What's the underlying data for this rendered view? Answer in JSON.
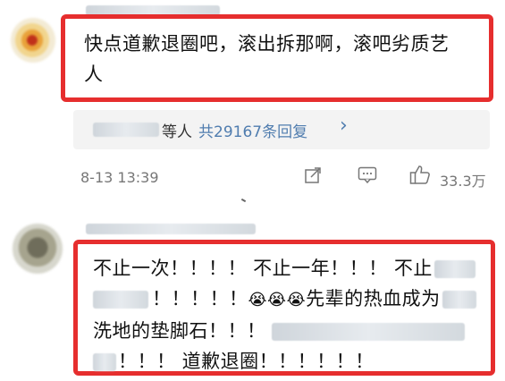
{
  "comments": [
    {
      "text_line1": "快点道歉退圈吧，滚出拆那啊，滚吧劣质艺",
      "text_line2": "人",
      "reply_count_text": "共29167条回复",
      "reply_users_suffix": "等人",
      "reply_arrow": "›",
      "time": "8-13 13:39",
      "like_count": "33.3万"
    },
    {
      "line1_a": "不止一次！！！！ 不止一年！！！ 不止",
      "line2_a": "！！！！！",
      "line2_emoji": "😭😭😭",
      "line2_b": "先辈的热血成为",
      "line3": "洗地的垫脚石！！！",
      "line4": "！！！ 道歉退圈！！！！！！"
    }
  ],
  "icons": [
    "share-icon",
    "comment-icon",
    "like-icon"
  ],
  "colors": {
    "highlight": "#e62e2e",
    "link": "#507daf",
    "meta": "#777777"
  }
}
